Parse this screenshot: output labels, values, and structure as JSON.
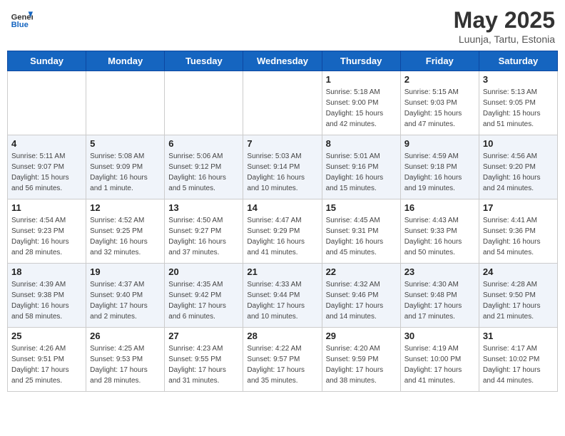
{
  "header": {
    "logo_general": "General",
    "logo_blue": "Blue",
    "title": "May 2025",
    "subtitle": "Luunja, Tartu, Estonia"
  },
  "days_of_week": [
    "Sunday",
    "Monday",
    "Tuesday",
    "Wednesday",
    "Thursday",
    "Friday",
    "Saturday"
  ],
  "weeks": [
    [
      {
        "day": "",
        "info": ""
      },
      {
        "day": "",
        "info": ""
      },
      {
        "day": "",
        "info": ""
      },
      {
        "day": "",
        "info": ""
      },
      {
        "day": "1",
        "info": "Sunrise: 5:18 AM\nSunset: 9:00 PM\nDaylight: 15 hours\nand 42 minutes."
      },
      {
        "day": "2",
        "info": "Sunrise: 5:15 AM\nSunset: 9:03 PM\nDaylight: 15 hours\nand 47 minutes."
      },
      {
        "day": "3",
        "info": "Sunrise: 5:13 AM\nSunset: 9:05 PM\nDaylight: 15 hours\nand 51 minutes."
      }
    ],
    [
      {
        "day": "4",
        "info": "Sunrise: 5:11 AM\nSunset: 9:07 PM\nDaylight: 15 hours\nand 56 minutes."
      },
      {
        "day": "5",
        "info": "Sunrise: 5:08 AM\nSunset: 9:09 PM\nDaylight: 16 hours\nand 1 minute."
      },
      {
        "day": "6",
        "info": "Sunrise: 5:06 AM\nSunset: 9:12 PM\nDaylight: 16 hours\nand 5 minutes."
      },
      {
        "day": "7",
        "info": "Sunrise: 5:03 AM\nSunset: 9:14 PM\nDaylight: 16 hours\nand 10 minutes."
      },
      {
        "day": "8",
        "info": "Sunrise: 5:01 AM\nSunset: 9:16 PM\nDaylight: 16 hours\nand 15 minutes."
      },
      {
        "day": "9",
        "info": "Sunrise: 4:59 AM\nSunset: 9:18 PM\nDaylight: 16 hours\nand 19 minutes."
      },
      {
        "day": "10",
        "info": "Sunrise: 4:56 AM\nSunset: 9:20 PM\nDaylight: 16 hours\nand 24 minutes."
      }
    ],
    [
      {
        "day": "11",
        "info": "Sunrise: 4:54 AM\nSunset: 9:23 PM\nDaylight: 16 hours\nand 28 minutes."
      },
      {
        "day": "12",
        "info": "Sunrise: 4:52 AM\nSunset: 9:25 PM\nDaylight: 16 hours\nand 32 minutes."
      },
      {
        "day": "13",
        "info": "Sunrise: 4:50 AM\nSunset: 9:27 PM\nDaylight: 16 hours\nand 37 minutes."
      },
      {
        "day": "14",
        "info": "Sunrise: 4:47 AM\nSunset: 9:29 PM\nDaylight: 16 hours\nand 41 minutes."
      },
      {
        "day": "15",
        "info": "Sunrise: 4:45 AM\nSunset: 9:31 PM\nDaylight: 16 hours\nand 45 minutes."
      },
      {
        "day": "16",
        "info": "Sunrise: 4:43 AM\nSunset: 9:33 PM\nDaylight: 16 hours\nand 50 minutes."
      },
      {
        "day": "17",
        "info": "Sunrise: 4:41 AM\nSunset: 9:36 PM\nDaylight: 16 hours\nand 54 minutes."
      }
    ],
    [
      {
        "day": "18",
        "info": "Sunrise: 4:39 AM\nSunset: 9:38 PM\nDaylight: 16 hours\nand 58 minutes."
      },
      {
        "day": "19",
        "info": "Sunrise: 4:37 AM\nSunset: 9:40 PM\nDaylight: 17 hours\nand 2 minutes."
      },
      {
        "day": "20",
        "info": "Sunrise: 4:35 AM\nSunset: 9:42 PM\nDaylight: 17 hours\nand 6 minutes."
      },
      {
        "day": "21",
        "info": "Sunrise: 4:33 AM\nSunset: 9:44 PM\nDaylight: 17 hours\nand 10 minutes."
      },
      {
        "day": "22",
        "info": "Sunrise: 4:32 AM\nSunset: 9:46 PM\nDaylight: 17 hours\nand 14 minutes."
      },
      {
        "day": "23",
        "info": "Sunrise: 4:30 AM\nSunset: 9:48 PM\nDaylight: 17 hours\nand 17 minutes."
      },
      {
        "day": "24",
        "info": "Sunrise: 4:28 AM\nSunset: 9:50 PM\nDaylight: 17 hours\nand 21 minutes."
      }
    ],
    [
      {
        "day": "25",
        "info": "Sunrise: 4:26 AM\nSunset: 9:51 PM\nDaylight: 17 hours\nand 25 minutes."
      },
      {
        "day": "26",
        "info": "Sunrise: 4:25 AM\nSunset: 9:53 PM\nDaylight: 17 hours\nand 28 minutes."
      },
      {
        "day": "27",
        "info": "Sunrise: 4:23 AM\nSunset: 9:55 PM\nDaylight: 17 hours\nand 31 minutes."
      },
      {
        "day": "28",
        "info": "Sunrise: 4:22 AM\nSunset: 9:57 PM\nDaylight: 17 hours\nand 35 minutes."
      },
      {
        "day": "29",
        "info": "Sunrise: 4:20 AM\nSunset: 9:59 PM\nDaylight: 17 hours\nand 38 minutes."
      },
      {
        "day": "30",
        "info": "Sunrise: 4:19 AM\nSunset: 10:00 PM\nDaylight: 17 hours\nand 41 minutes."
      },
      {
        "day": "31",
        "info": "Sunrise: 4:17 AM\nSunset: 10:02 PM\nDaylight: 17 hours\nand 44 minutes."
      }
    ]
  ]
}
